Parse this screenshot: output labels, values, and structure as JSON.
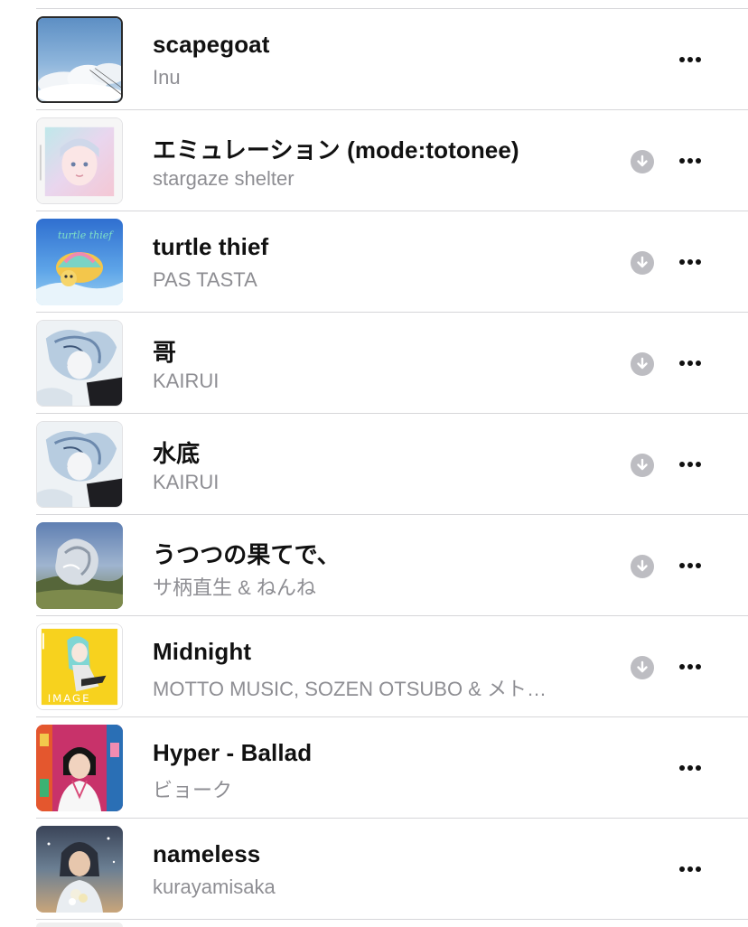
{
  "songs": [
    {
      "title": "scapegoat",
      "artist": "Inu",
      "art": "sky-clouds-art",
      "downloadable": false
    },
    {
      "title": "エミュレーション (mode:totonee)",
      "artist": "stargaze shelter",
      "art": "pastel-girl-art",
      "downloadable": true
    },
    {
      "title": "turtle thief",
      "artist": "PAS TASTA",
      "art": "turtle-art",
      "downloadable": true
    },
    {
      "title": "哥",
      "artist": "KAIRUI",
      "art": "ink-character-art",
      "downloadable": true
    },
    {
      "title": "水底",
      "artist": "KAIRUI",
      "art": "ink-character-art",
      "downloadable": true
    },
    {
      "title": "うつつの果てで、",
      "artist": "サ柄直生 & ねんね",
      "art": "silver-landscape-art",
      "downloadable": true
    },
    {
      "title": "Midnight",
      "artist": "MOTTO MUSIC, SOZEN OTSUBO & メト…",
      "art": "yellow-image-art",
      "downloadable": true
    },
    {
      "title": "Hyper - Ballad",
      "artist": "ビョーク",
      "art": "pink-portrait-art",
      "downloadable": false
    },
    {
      "title": "nameless",
      "artist": "kurayamisaka",
      "art": "girl-flowers-art",
      "downloadable": false
    }
  ],
  "art_texts": {
    "turtle": "turtle thief",
    "image": "IMAGE"
  },
  "colors": {
    "title": "#111111",
    "subtitle": "#8e8e93",
    "divider": "#d6d6d9",
    "download_badge": "#bdbdc2"
  },
  "icons": {
    "download": "arrow-down-circle-icon",
    "more": "ellipsis-icon"
  }
}
